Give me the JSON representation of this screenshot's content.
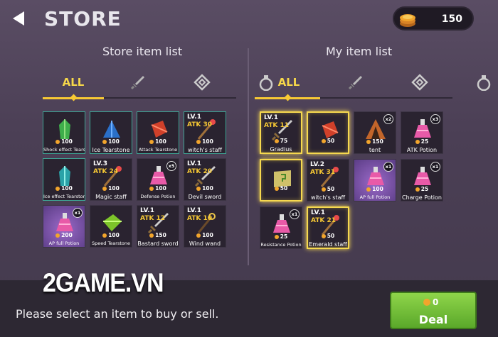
{
  "header": {
    "title": "STORE",
    "coins": "150"
  },
  "store": {
    "title": "Store item list",
    "all_label": "ALL",
    "items": [
      {
        "name": "Shock effect Tearstone",
        "price": "100",
        "icon": "green-crystal-icon"
      },
      {
        "name": "Ice Tearstone",
        "price": "100",
        "icon": "blue-crystal-icon"
      },
      {
        "name": "Attack Tearstone",
        "price": "100",
        "icon": "red-crystal-icon"
      },
      {
        "name": "witch's staff",
        "price": "100",
        "lv": "LV.1",
        "atk": "ATK 30",
        "icon": "staff-icon"
      },
      {
        "name": "Ice effect Tearstone",
        "price": "100",
        "icon": "teal-crystal-icon"
      },
      {
        "name": "Magic staff",
        "price": "100",
        "lv": "LV.3",
        "atk": "ATK 24",
        "icon": "staff-icon"
      },
      {
        "name": "Defense Potion",
        "price": "100",
        "count": "x5",
        "icon": "potion-icon"
      },
      {
        "name": "Devil sword",
        "price": "100",
        "lv": "LV.1",
        "atk": "ATK 20",
        "icon": "sword-icon"
      },
      {
        "name": "AP full Potion",
        "price": "200",
        "count": "x1",
        "icon": "potion-icon"
      },
      {
        "name": "Speed Tearstone",
        "price": "100",
        "icon": "lime-crystal-icon"
      },
      {
        "name": "Bastard sword",
        "price": "150",
        "lv": "LV.1",
        "atk": "ATK 12",
        "icon": "sword-icon"
      },
      {
        "name": "Wind wand",
        "price": "100",
        "lv": "LV.1",
        "atk": "ATK 10",
        "icon": "wand-icon"
      }
    ]
  },
  "mine": {
    "title": "My item list",
    "all_label": "ALL",
    "items": [
      {
        "name": "Gradius",
        "price": "75",
        "lv": "LV.1",
        "atk": "ATK 11",
        "icon": "sword-icon"
      },
      {
        "name": "",
        "price": "50",
        "icon": "red-crystal-icon"
      },
      {
        "name": "tent",
        "price": "150",
        "count": "x2",
        "icon": "tent-icon"
      },
      {
        "name": "ATK Potion",
        "price": "25",
        "count": "x3",
        "icon": "potion-icon"
      },
      {
        "name": "",
        "price": "50",
        "icon": "scroll-icon"
      },
      {
        "name": "witch's staff",
        "price": "50",
        "lv": "LV.2",
        "atk": "ATK 31",
        "icon": "staff-icon"
      },
      {
        "name": "AP full Potion",
        "price": "100",
        "count": "x1",
        "icon": "potion-icon"
      },
      {
        "name": "Charge Potion",
        "price": "25",
        "count": "x1",
        "icon": "potion-icon"
      },
      {
        "name": "Resistance Potion",
        "price": "25",
        "count": "x1",
        "icon": "potion-icon"
      },
      {
        "name": "Emerald staff",
        "price": "50",
        "lv": "LV.1",
        "atk": "ATK 21",
        "icon": "staff-icon"
      }
    ]
  },
  "footer": {
    "hint": "Please select an item to buy or sell.",
    "deal_cost": "0",
    "deal_label": "Deal",
    "watermark": "2GAME.VN"
  },
  "colors": {
    "accent": "#f7c934",
    "selected": "#f6d84f",
    "deal": "#7cc63c"
  }
}
